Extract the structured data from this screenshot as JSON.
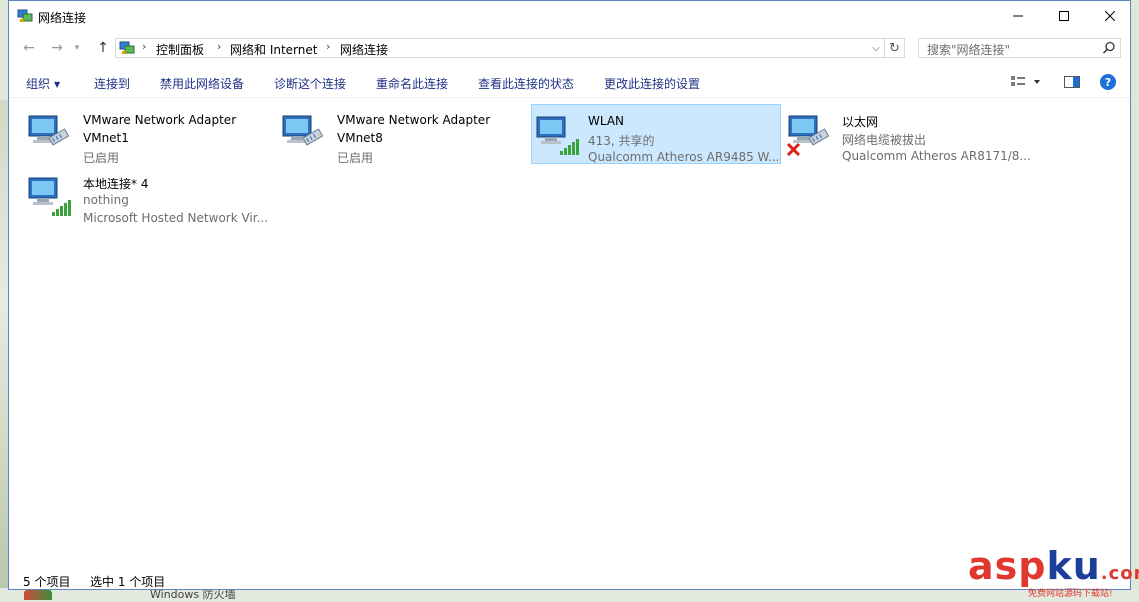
{
  "window": {
    "title": "网络连接"
  },
  "nav": {
    "breadcrumbs": [
      "控制面板",
      "网络和 Internet",
      "网络连接"
    ],
    "search_placeholder": "搜索\"网络连接\""
  },
  "toolbar": {
    "organize": "组织",
    "connect_to": "连接到",
    "disable": "禁用此网络设备",
    "diagnose": "诊断这个连接",
    "rename": "重命名此连接",
    "view_status": "查看此连接的状态",
    "change_settings": "更改此连接的设置"
  },
  "connections": [
    {
      "name": "VMware Network Adapter VMnet1",
      "status": "已启用",
      "device": "",
      "type": "ethernet",
      "selected": false,
      "disconnected": false
    },
    {
      "name": "VMware Network Adapter VMnet8",
      "status": "已启用",
      "device": "",
      "type": "ethernet",
      "selected": false,
      "disconnected": false
    },
    {
      "name": "WLAN",
      "status": "413, 共享的",
      "device": "Qualcomm Atheros AR9485 W...",
      "type": "wireless",
      "selected": true,
      "disconnected": false
    },
    {
      "name": "以太网",
      "status": "网络电缆被拔出",
      "device": "Qualcomm Atheros AR8171/8...",
      "type": "ethernet",
      "selected": false,
      "disconnected": true
    },
    {
      "name": "本地连接* 4",
      "status": "nothing",
      "device": "Microsoft Hosted Network Vir...",
      "type": "wireless",
      "selected": false,
      "disconnected": false
    }
  ],
  "vmnet1": {
    "line1": "VMware Network Adapter",
    "line2": "VMnet1"
  },
  "vmnet8": {
    "line1": "VMware Network Adapter",
    "line2": "VMnet8"
  },
  "statusbar": {
    "count": "5 个项目",
    "selected": "选中 1 个项目"
  },
  "desktop": {
    "behind_text": "Windows 防火墙"
  },
  "watermark": {
    "main_a": "asp",
    "main_b": "ku",
    "main_c": ".com",
    "sub": "免费网站源码下载站!"
  },
  "colors": {
    "accent": "#1e3287",
    "selection": "#cce8ff",
    "selection_border": "#99d1ff",
    "watermark_red": "#e0372f",
    "watermark_blue": "#1c3f9a"
  }
}
